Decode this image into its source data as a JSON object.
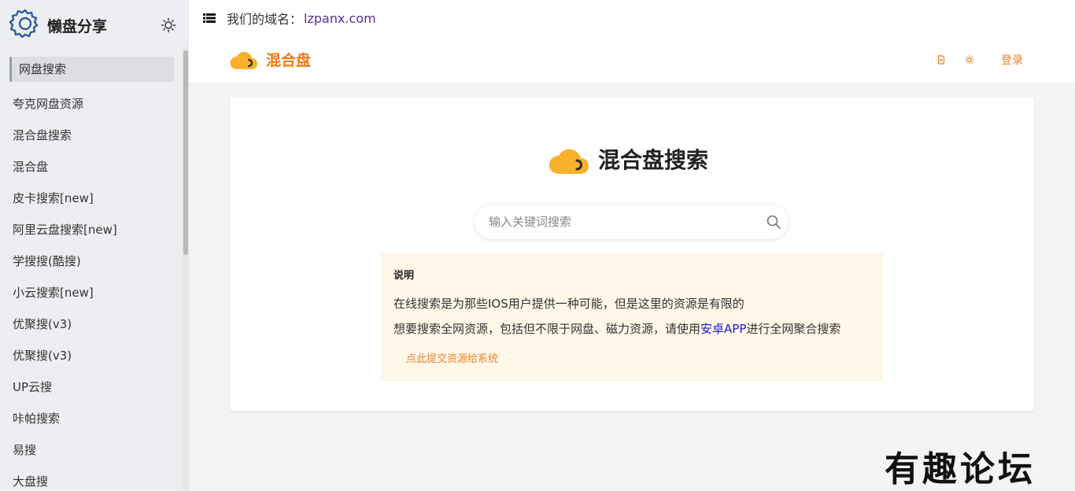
{
  "sidebar": {
    "brand_title": "懒盘分享",
    "items": [
      {
        "label": "网盘搜索",
        "active": true
      },
      {
        "label": "夸克网盘资源"
      },
      {
        "label": "混合盘搜索"
      },
      {
        "label": "混合盘"
      },
      {
        "label": "皮卡搜索[new]"
      },
      {
        "label": "阿里云盘搜索[new]"
      },
      {
        "label": "学搜搜(酷搜)"
      },
      {
        "label": "小云搜索[new]"
      },
      {
        "label": "优聚搜(v3)"
      },
      {
        "label": "优聚搜(v3)"
      },
      {
        "label": "UP云搜"
      },
      {
        "label": "咔帕搜索"
      },
      {
        "label": "易搜"
      },
      {
        "label": "大盘搜"
      }
    ]
  },
  "topbar": {
    "domain_prefix": "我们的域名：",
    "domain": "lzpanx.com",
    "logo_text": "混合盘",
    "login_label": "登录"
  },
  "main": {
    "title": "混合盘搜索",
    "search_placeholder": "输入关键词搜索",
    "notice_title": "说明",
    "notice_line1": "在线搜索是为那些IOS用户提供一种可能，但是这里的资源是有限的",
    "notice_line2_prefix": "想要搜索全网资源，包括但不限于网盘、磁力资源，请使用",
    "notice_app_link": "安卓APP",
    "notice_line2_suffix": "进行全网聚合搜索",
    "submit_link": "点此提交资源给系统"
  },
  "watermark": "有趣论坛",
  "colors": {
    "accent": "#f07c16",
    "cloud": "#f9b02b",
    "link": "#1a1ad6"
  }
}
